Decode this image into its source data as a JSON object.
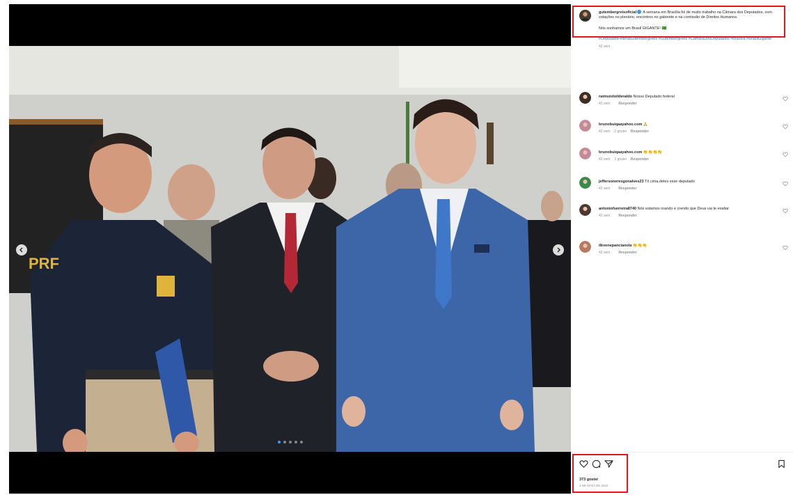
{
  "post": {
    "username": "gutembergreisoficial",
    "caption_text": "A semana em Brasília foi de muito trabalho na Câmara dos Deputados, com votações no plenário, encontros no gabinete e na comissão de Direitos Humanos.",
    "caption_line2": "Nós sonhamos um Brasil GIGANTE! 🇧🇷",
    "hashtags": "#DeputadoFederalGutembergReis #GutembergReis #CâmaraDosDeputados #Brasília #BrasilGigante",
    "time_ago": "42 sem"
  },
  "comments": [
    {
      "username": "raimundoilderaldo",
      "text": "Nosso Deputado federal",
      "time": "42 sem",
      "likes": "",
      "reply": "Responder"
    },
    {
      "username": "brunobuiqaayahoo.com",
      "text": "🙏",
      "time": "42 sem",
      "likes": "2 gostei",
      "reply": "Responder"
    },
    {
      "username": "brunobuiqaayahoo.com",
      "text": "👏👏👏👏",
      "time": "42 sem",
      "likes": "1 gostei",
      "reply": "Responder"
    },
    {
      "username": "jeffersoneresgonalves23",
      "text": "Tô cima deles esse deputado",
      "time": "42 sem",
      "likes": "",
      "reply": "Responder"
    },
    {
      "username": "antoniofserreira8740",
      "text": "Nós estamos orando e crendo que Deus vai te exaltar",
      "time": "42 sem",
      "likes": "",
      "reply": "Responder"
    },
    {
      "username": "ilkvenepancianola",
      "text": "👏👏👏",
      "time": "42 sem",
      "likes": "",
      "reply": "Responder"
    }
  ],
  "footer": {
    "likes_label": "373 gostei",
    "date_label": "4 DE MAIO DE 2022"
  },
  "carousel": {
    "total": 5,
    "active": 1
  },
  "icons": {
    "like": "heart-icon",
    "comment": "comment-icon",
    "share": "share-icon",
    "save": "bookmark-icon",
    "prev": "chevron-left-icon",
    "next": "chevron-right-icon",
    "verified": "verified-badge-icon"
  },
  "colors": {
    "highlight": "#e4151e",
    "link": "#3b6fa8",
    "muted": "#8e8e8e",
    "verified": "#3897f0"
  }
}
